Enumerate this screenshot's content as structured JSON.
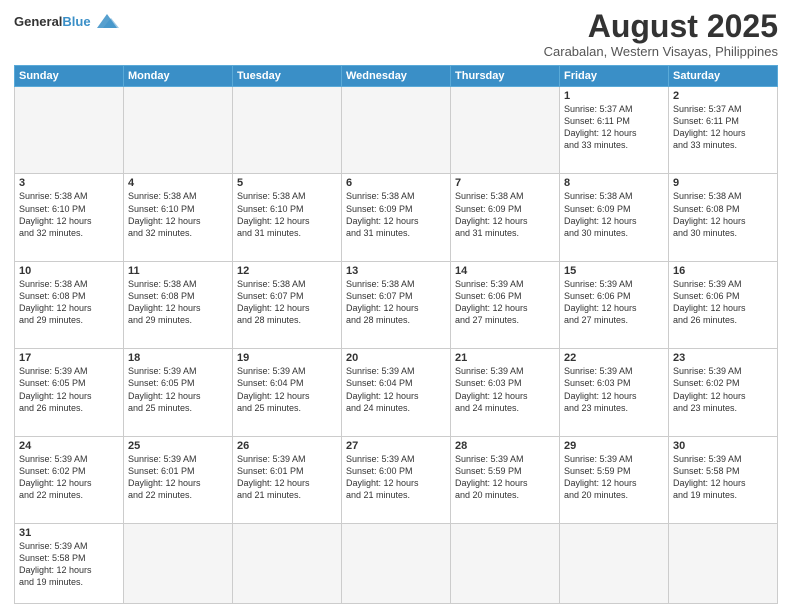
{
  "header": {
    "logo_line1": "General",
    "logo_line2": "Blue",
    "month_title": "August 2025",
    "subtitle": "Carabalan, Western Visayas, Philippines"
  },
  "days_of_week": [
    "Sunday",
    "Monday",
    "Tuesday",
    "Wednesday",
    "Thursday",
    "Friday",
    "Saturday"
  ],
  "weeks": [
    [
      {
        "num": "",
        "info": "",
        "empty": true
      },
      {
        "num": "",
        "info": "",
        "empty": true
      },
      {
        "num": "",
        "info": "",
        "empty": true
      },
      {
        "num": "",
        "info": "",
        "empty": true
      },
      {
        "num": "",
        "info": "",
        "empty": true
      },
      {
        "num": "1",
        "info": "Sunrise: 5:37 AM\nSunset: 6:11 PM\nDaylight: 12 hours\nand 33 minutes.",
        "empty": false
      },
      {
        "num": "2",
        "info": "Sunrise: 5:37 AM\nSunset: 6:11 PM\nDaylight: 12 hours\nand 33 minutes.",
        "empty": false
      }
    ],
    [
      {
        "num": "3",
        "info": "Sunrise: 5:38 AM\nSunset: 6:10 PM\nDaylight: 12 hours\nand 32 minutes.",
        "empty": false
      },
      {
        "num": "4",
        "info": "Sunrise: 5:38 AM\nSunset: 6:10 PM\nDaylight: 12 hours\nand 32 minutes.",
        "empty": false
      },
      {
        "num": "5",
        "info": "Sunrise: 5:38 AM\nSunset: 6:10 PM\nDaylight: 12 hours\nand 31 minutes.",
        "empty": false
      },
      {
        "num": "6",
        "info": "Sunrise: 5:38 AM\nSunset: 6:09 PM\nDaylight: 12 hours\nand 31 minutes.",
        "empty": false
      },
      {
        "num": "7",
        "info": "Sunrise: 5:38 AM\nSunset: 6:09 PM\nDaylight: 12 hours\nand 31 minutes.",
        "empty": false
      },
      {
        "num": "8",
        "info": "Sunrise: 5:38 AM\nSunset: 6:09 PM\nDaylight: 12 hours\nand 30 minutes.",
        "empty": false
      },
      {
        "num": "9",
        "info": "Sunrise: 5:38 AM\nSunset: 6:08 PM\nDaylight: 12 hours\nand 30 minutes.",
        "empty": false
      }
    ],
    [
      {
        "num": "10",
        "info": "Sunrise: 5:38 AM\nSunset: 6:08 PM\nDaylight: 12 hours\nand 29 minutes.",
        "empty": false
      },
      {
        "num": "11",
        "info": "Sunrise: 5:38 AM\nSunset: 6:08 PM\nDaylight: 12 hours\nand 29 minutes.",
        "empty": false
      },
      {
        "num": "12",
        "info": "Sunrise: 5:38 AM\nSunset: 6:07 PM\nDaylight: 12 hours\nand 28 minutes.",
        "empty": false
      },
      {
        "num": "13",
        "info": "Sunrise: 5:38 AM\nSunset: 6:07 PM\nDaylight: 12 hours\nand 28 minutes.",
        "empty": false
      },
      {
        "num": "14",
        "info": "Sunrise: 5:39 AM\nSunset: 6:06 PM\nDaylight: 12 hours\nand 27 minutes.",
        "empty": false
      },
      {
        "num": "15",
        "info": "Sunrise: 5:39 AM\nSunset: 6:06 PM\nDaylight: 12 hours\nand 27 minutes.",
        "empty": false
      },
      {
        "num": "16",
        "info": "Sunrise: 5:39 AM\nSunset: 6:06 PM\nDaylight: 12 hours\nand 26 minutes.",
        "empty": false
      }
    ],
    [
      {
        "num": "17",
        "info": "Sunrise: 5:39 AM\nSunset: 6:05 PM\nDaylight: 12 hours\nand 26 minutes.",
        "empty": false
      },
      {
        "num": "18",
        "info": "Sunrise: 5:39 AM\nSunset: 6:05 PM\nDaylight: 12 hours\nand 25 minutes.",
        "empty": false
      },
      {
        "num": "19",
        "info": "Sunrise: 5:39 AM\nSunset: 6:04 PM\nDaylight: 12 hours\nand 25 minutes.",
        "empty": false
      },
      {
        "num": "20",
        "info": "Sunrise: 5:39 AM\nSunset: 6:04 PM\nDaylight: 12 hours\nand 24 minutes.",
        "empty": false
      },
      {
        "num": "21",
        "info": "Sunrise: 5:39 AM\nSunset: 6:03 PM\nDaylight: 12 hours\nand 24 minutes.",
        "empty": false
      },
      {
        "num": "22",
        "info": "Sunrise: 5:39 AM\nSunset: 6:03 PM\nDaylight: 12 hours\nand 23 minutes.",
        "empty": false
      },
      {
        "num": "23",
        "info": "Sunrise: 5:39 AM\nSunset: 6:02 PM\nDaylight: 12 hours\nand 23 minutes.",
        "empty": false
      }
    ],
    [
      {
        "num": "24",
        "info": "Sunrise: 5:39 AM\nSunset: 6:02 PM\nDaylight: 12 hours\nand 22 minutes.",
        "empty": false
      },
      {
        "num": "25",
        "info": "Sunrise: 5:39 AM\nSunset: 6:01 PM\nDaylight: 12 hours\nand 22 minutes.",
        "empty": false
      },
      {
        "num": "26",
        "info": "Sunrise: 5:39 AM\nSunset: 6:01 PM\nDaylight: 12 hours\nand 21 minutes.",
        "empty": false
      },
      {
        "num": "27",
        "info": "Sunrise: 5:39 AM\nSunset: 6:00 PM\nDaylight: 12 hours\nand 21 minutes.",
        "empty": false
      },
      {
        "num": "28",
        "info": "Sunrise: 5:39 AM\nSunset: 5:59 PM\nDaylight: 12 hours\nand 20 minutes.",
        "empty": false
      },
      {
        "num": "29",
        "info": "Sunrise: 5:39 AM\nSunset: 5:59 PM\nDaylight: 12 hours\nand 20 minutes.",
        "empty": false
      },
      {
        "num": "30",
        "info": "Sunrise: 5:39 AM\nSunset: 5:58 PM\nDaylight: 12 hours\nand 19 minutes.",
        "empty": false
      }
    ],
    [
      {
        "num": "31",
        "info": "Sunrise: 5:39 AM\nSunset: 5:58 PM\nDaylight: 12 hours\nand 19 minutes.",
        "empty": false
      },
      {
        "num": "",
        "info": "",
        "empty": true
      },
      {
        "num": "",
        "info": "",
        "empty": true
      },
      {
        "num": "",
        "info": "",
        "empty": true
      },
      {
        "num": "",
        "info": "",
        "empty": true
      },
      {
        "num": "",
        "info": "",
        "empty": true
      },
      {
        "num": "",
        "info": "",
        "empty": true
      }
    ]
  ]
}
